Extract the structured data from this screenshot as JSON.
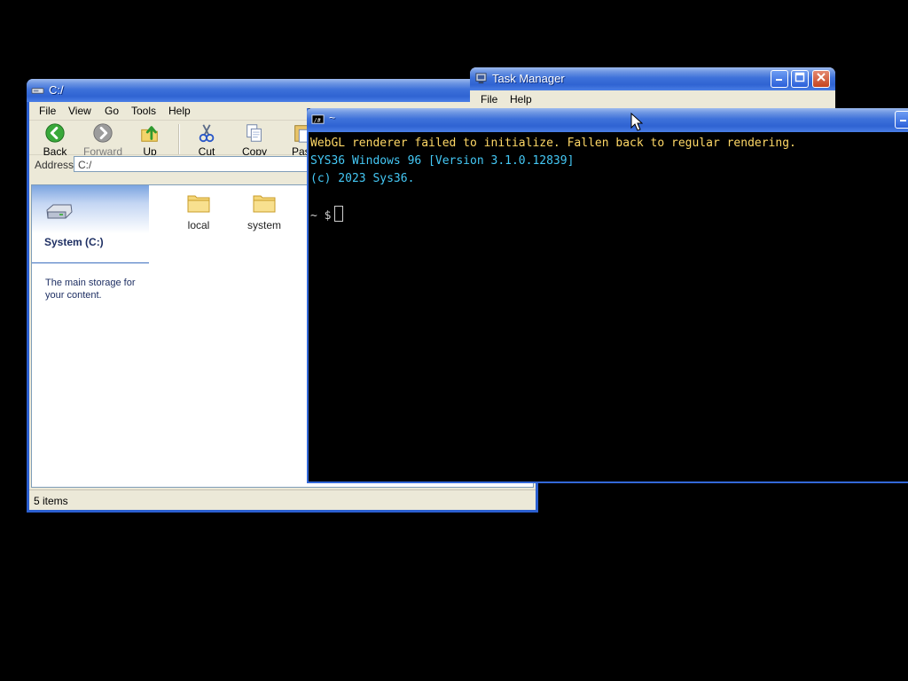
{
  "explorer": {
    "title": "C:/",
    "menu": [
      "File",
      "View",
      "Go",
      "Tools",
      "Help"
    ],
    "toolbar": {
      "back": "Back",
      "forward": "Forward",
      "up": "Up",
      "cut": "Cut",
      "copy": "Copy",
      "paste": "Past"
    },
    "address_label": "Address",
    "address_value": "C:/",
    "side": {
      "drive_name": "System (C:)",
      "description": "The main storage for your content."
    },
    "files": [
      {
        "name": "local",
        "icon": "folder-icon"
      },
      {
        "name": "system",
        "icon": "folder-icon"
      }
    ],
    "status": "5 items"
  },
  "taskmgr": {
    "title": "Task Manager",
    "menu": [
      "File",
      "Help"
    ]
  },
  "terminal": {
    "title": "~",
    "lines": [
      "WebGL renderer failed to initialize. Fallen back to regular rendering.",
      "SYS36 Windows 96 [Version 3.1.0.12839]",
      "(c) 2023 Sys36."
    ],
    "prompt": "~ $"
  },
  "colors": {
    "titlebar_blue": "#2f63d2",
    "terminal_warning": "#ffd866",
    "terminal_info": "#44c8f5"
  }
}
